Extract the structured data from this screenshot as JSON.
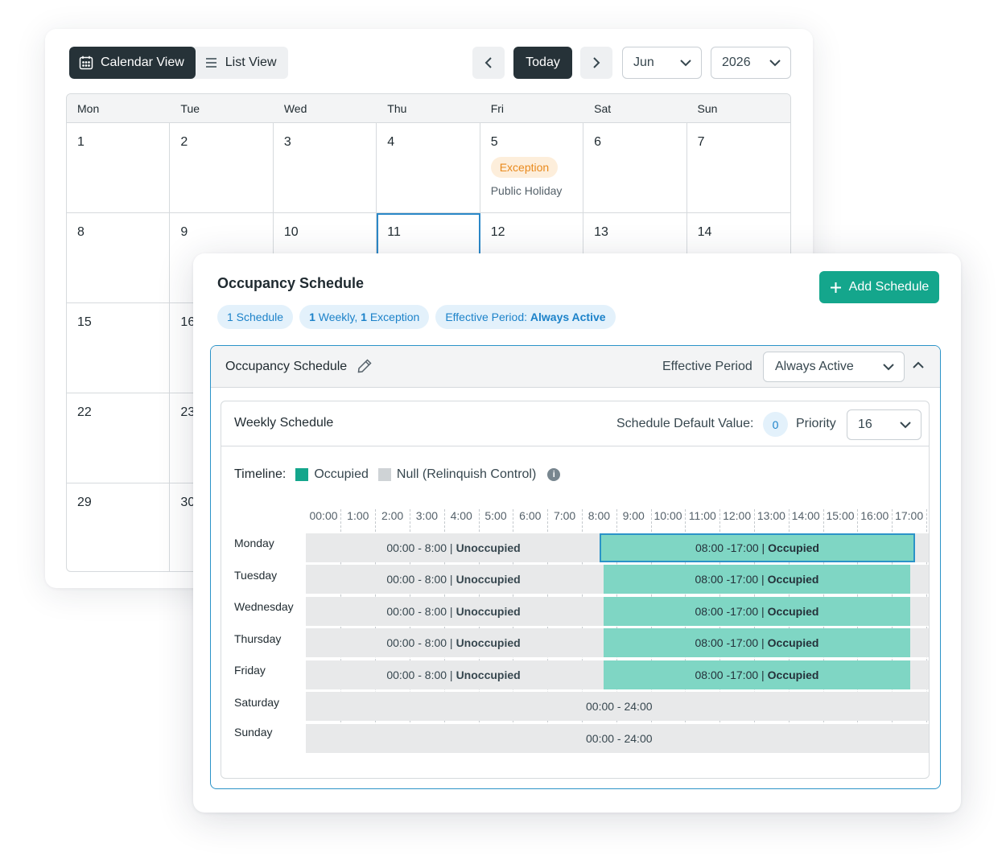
{
  "calendar": {
    "view_toggle": {
      "calendar_label": "Calendar View",
      "list_label": "List View"
    },
    "nav": {
      "today_label": "Today",
      "month": "Jun",
      "year": "2026"
    },
    "weekdays": [
      "Mon",
      "Tue",
      "Wed",
      "Thu",
      "Fri",
      "Sat",
      "Sun"
    ],
    "weeks": [
      [
        "1",
        "2",
        "3",
        "4",
        "5",
        "6",
        "7"
      ],
      [
        "8",
        "9",
        "10",
        "11",
        "12",
        "13",
        "14"
      ],
      [
        "15",
        "16",
        "",
        "",
        "",
        "",
        ""
      ],
      [
        "22",
        "23",
        "",
        "",
        "",
        "",
        ""
      ],
      [
        "29",
        "30",
        "",
        "",
        "",
        "",
        ""
      ]
    ],
    "exception": {
      "badge": "Exception",
      "description": "Public Holiday"
    },
    "today_date": "11"
  },
  "schedule": {
    "title": "Occupancy Schedule",
    "add_button": "Add Schedule",
    "chips": {
      "count": "1 Schedule",
      "weekly_num": "1",
      "weekly_text": " Weekly, ",
      "exc_num": "1",
      "exc_text": " Exception",
      "period_label": "Effective Period: ",
      "period_value": "Always Active"
    },
    "block": {
      "title": "Occupancy Schedule",
      "effective_period_label": "Effective Period",
      "effective_period_value": "Always Active"
    },
    "weekly": {
      "title": "Weekly Schedule",
      "default_label": "Schedule Default Value:",
      "default_value": "0",
      "priority_label": "Priority",
      "priority_value": "16"
    },
    "legend": {
      "title": "Timeline:",
      "occupied": "Occupied",
      "null": "Null (Relinquish Control)"
    },
    "hours": [
      "00:00",
      "1:00",
      "2:00",
      "3:00",
      "4:00",
      "5:00",
      "6:00",
      "7:00",
      "8:00",
      "9:00",
      "10:00",
      "11:00",
      "12:00",
      "13:00",
      "14:00",
      "15:00",
      "16:00",
      "17:00"
    ],
    "rows": [
      {
        "day": "Monday",
        "unocc_range": "00:00 - 8:00 |",
        "unocc_label": "Unoccupied",
        "occ_range": "08:00 -17:00 |",
        "occ_label": "Occupied"
      },
      {
        "day": "Tuesday",
        "unocc_range": "00:00 - 8:00 |",
        "unocc_label": "Unoccupied",
        "occ_range": "08:00 -17:00 |",
        "occ_label": "Occupied"
      },
      {
        "day": "Wednesday",
        "unocc_range": "00:00 - 8:00 |",
        "unocc_label": "Unoccupied",
        "occ_range": "08:00 -17:00 |",
        "occ_label": "Occupied"
      },
      {
        "day": "Thursday",
        "unocc_range": "00:00 - 8:00 |",
        "unocc_label": "Unoccupied",
        "occ_range": "08:00 -17:00 |",
        "occ_label": "Occupied"
      },
      {
        "day": "Friday",
        "unocc_range": "00:00 - 8:00 |",
        "unocc_label": "Unoccupied",
        "occ_range": "08:00 -17:00 |",
        "occ_label": "Occupied"
      },
      {
        "day": "Saturday",
        "full_range": "00:00 - 24:00"
      },
      {
        "day": "Sunday",
        "full_range": "00:00 - 24:00"
      }
    ]
  },
  "colors": {
    "accent": "#14a68c",
    "occupied_fill": "#7fd6c4",
    "dark": "#263238",
    "selection": "#2b93c8",
    "exception": "#e98a1d"
  },
  "icons": [
    "calendar-icon",
    "list-icon",
    "chevron-left-icon",
    "chevron-right-icon",
    "chevron-down-icon",
    "plus-icon",
    "pencil-icon",
    "chevron-up-icon",
    "info-icon"
  ]
}
